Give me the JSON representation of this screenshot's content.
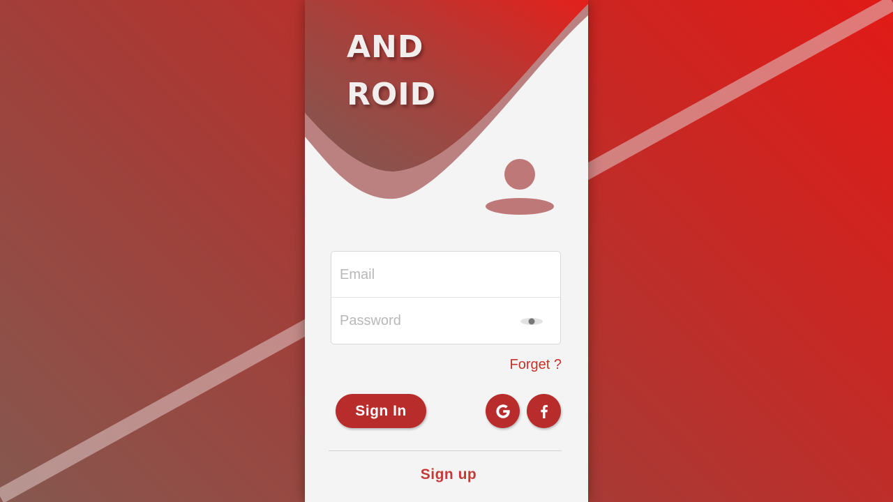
{
  "logo": {
    "line1": "AND",
    "line2": "ROID"
  },
  "login_form": {
    "email_placeholder": "Email",
    "password_placeholder": "Password"
  },
  "links": {
    "forget": "Forget ?",
    "signup": "Sign up"
  },
  "buttons": {
    "signin": "Sign In"
  },
  "social": [
    {
      "icon": "google-icon"
    },
    {
      "icon": "facebook-icon"
    }
  ],
  "colors": {
    "accent": "#b92c2c",
    "background_top": "#e11a17",
    "background_bottom": "#85584f",
    "card": "#f4f4f4"
  }
}
